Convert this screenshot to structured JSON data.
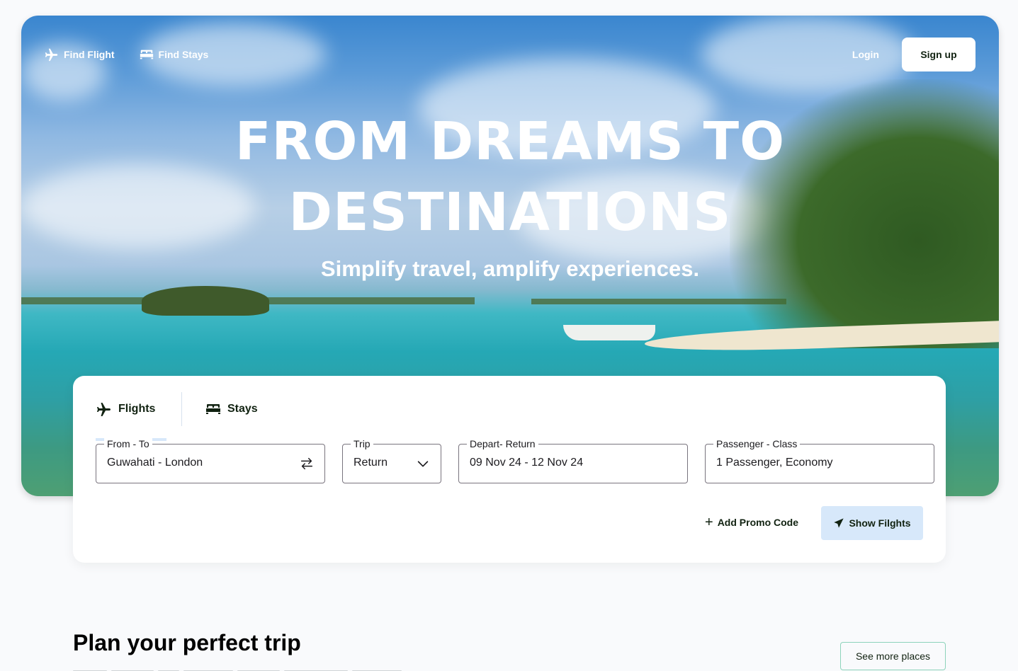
{
  "nav": {
    "find_flight": "Find Flight",
    "find_stays": "Find Stays",
    "login": "Login",
    "signup": "Sign up"
  },
  "hero": {
    "headline_line1": "FROM DREAMS TO",
    "headline_line2": "DESTINATIONS",
    "tagline": "Simplify travel, amplify experiences."
  },
  "search": {
    "tabs": [
      {
        "label": "Flights",
        "icon": "airplane-icon",
        "active": true
      },
      {
        "label": "Stays",
        "icon": "bed-icon",
        "active": false
      }
    ],
    "fields": {
      "from_to": {
        "label": "From - To",
        "value": "Guwahati - London",
        "icon": "swap-icon"
      },
      "trip": {
        "label": "Trip",
        "value": "Return",
        "icon": "chevron-down-icon"
      },
      "dates": {
        "label": "Depart- Return",
        "value": "09 Nov 24 - 12 Nov 24"
      },
      "passenger": {
        "label": "Passenger - Class",
        "value": "1 Passenger, Economy"
      }
    },
    "promo_label": "Add Promo Code",
    "submit_label": "Show Filghts"
  },
  "section": {
    "title": "Plan your perfect trip",
    "see_more": "See more places"
  },
  "colors": {
    "accent_light_blue": "#d7e8fa",
    "mint_border": "#8dd3bb",
    "text_dark": "#112211",
    "page_bg": "#f9fafc"
  }
}
